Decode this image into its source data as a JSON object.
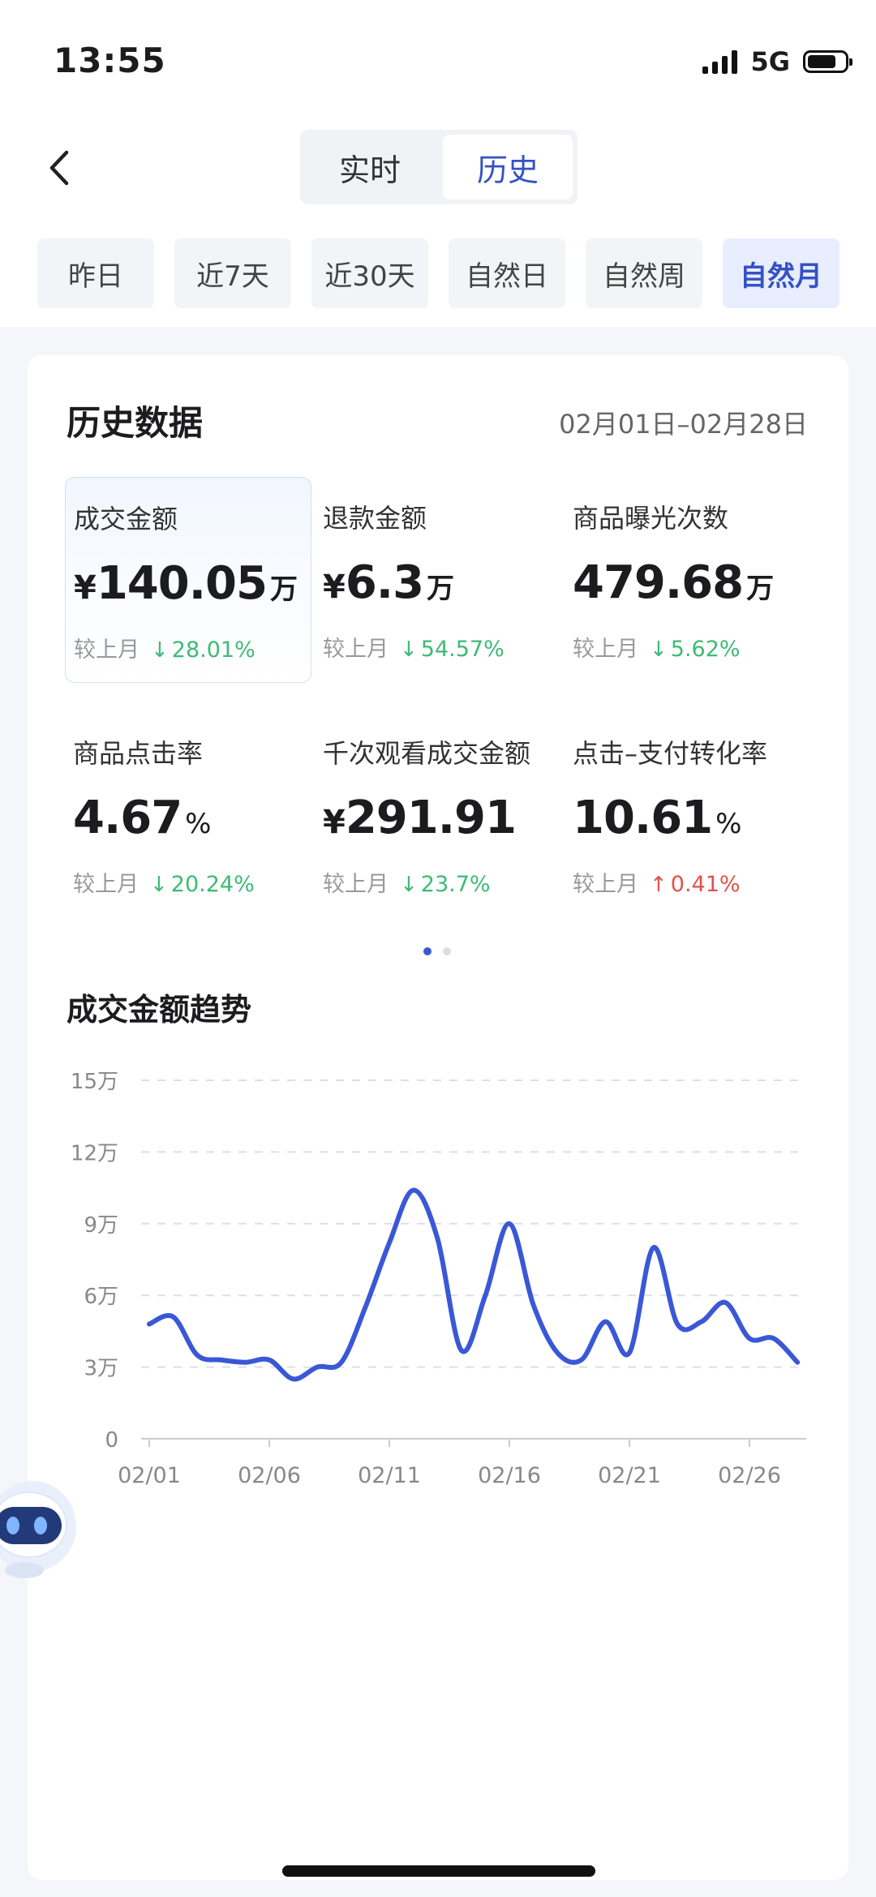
{
  "status": {
    "time": "13:55",
    "network": "5G"
  },
  "nav": {
    "segment_left": "实时",
    "segment_right": "历史"
  },
  "tabs": [
    "昨日",
    "近7天",
    "近30天",
    "自然日",
    "自然周",
    "自然月"
  ],
  "card": {
    "title": "历史数据",
    "date_range": "02月01日–02月28日",
    "metrics": [
      {
        "label": "成交金额",
        "currency": "¥",
        "value": "140.05",
        "unit": "万",
        "compare_label": "较上月",
        "direction": "down",
        "arrow": "↓",
        "change": "28.01%"
      },
      {
        "label": "退款金额",
        "currency": "¥",
        "value": "6.3",
        "unit": "万",
        "compare_label": "较上月",
        "direction": "down",
        "arrow": "↓",
        "change": "54.57%"
      },
      {
        "label": "商品曝光次数",
        "currency": "",
        "value": "479.68",
        "unit": "万",
        "compare_label": "较上月",
        "direction": "down",
        "arrow": "↓",
        "change": "5.62%"
      },
      {
        "label": "商品点击率",
        "currency": "",
        "value": "4.67",
        "unit": "%",
        "compare_label": "较上月",
        "direction": "down",
        "arrow": "↓",
        "change": "20.24%"
      },
      {
        "label": "千次观看成交金额",
        "currency": "¥",
        "value": "291.91",
        "unit": "",
        "compare_label": "较上月",
        "direction": "down",
        "arrow": "↓",
        "change": "23.7%"
      },
      {
        "label": "点击–支付转化率",
        "currency": "",
        "value": "10.61",
        "unit": "%",
        "compare_label": "较上月",
        "direction": "up",
        "arrow": "↑",
        "change": "0.41%"
      }
    ],
    "trend_title": "成交金额趋势"
  },
  "colors": {
    "accent": "#3452c6",
    "line": "#3a58d6",
    "down": "#3dbb74",
    "up": "#e2514b"
  },
  "chart_data": {
    "type": "line",
    "title": "成交金额趋势",
    "y_ticks": [
      "0",
      "3万",
      "6万",
      "9万",
      "12万",
      "15万"
    ],
    "ylim": [
      0,
      15
    ],
    "x_ticks": [
      "02/01",
      "02/06",
      "02/11",
      "02/16",
      "02/21",
      "02/26"
    ],
    "grid": true,
    "series": [
      {
        "x": [
          "02/01",
          "02/02",
          "02/03",
          "02/04",
          "02/05",
          "02/06",
          "02/07",
          "02/08",
          "02/09",
          "02/10",
          "02/11",
          "02/12",
          "02/13",
          "02/14",
          "02/15",
          "02/16",
          "02/17",
          "02/18",
          "02/19",
          "02/20",
          "02/21",
          "02/22",
          "02/23",
          "02/24",
          "02/25",
          "02/26",
          "02/27",
          "02/28"
        ],
        "values": [
          4.8,
          5.1,
          3.5,
          3.3,
          3.2,
          3.3,
          2.5,
          3.0,
          3.2,
          5.5,
          8.2,
          10.4,
          8.4,
          3.7,
          6.0,
          9.0,
          5.6,
          3.6,
          3.3,
          4.9,
          3.6,
          8.0,
          4.8,
          4.9,
          5.7,
          4.2,
          4.2,
          3.2
        ]
      }
    ]
  }
}
